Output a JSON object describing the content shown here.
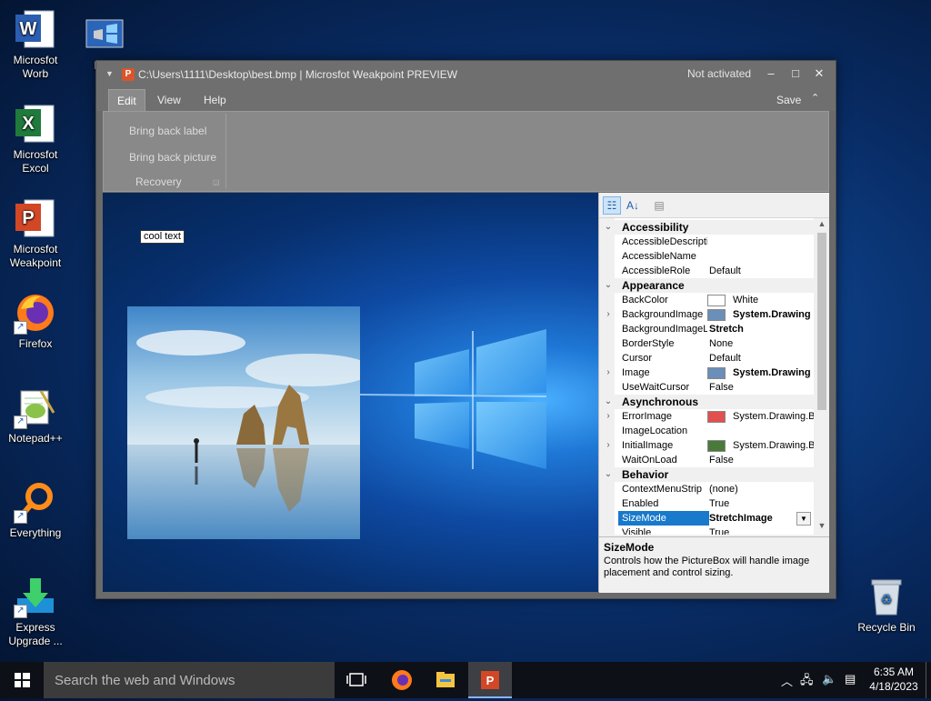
{
  "desktop": {
    "icons": [
      {
        "label": "Microsfot Worb",
        "icon": "word-icon"
      },
      {
        "label": "Microsfot Excol",
        "icon": "excel-icon"
      },
      {
        "label": "Microsfot Weakpoint",
        "icon": "powerpoint-icon"
      },
      {
        "label": "Firefox",
        "icon": "firefox-icon"
      },
      {
        "label": "Notepad++",
        "icon": "notepad-plus-plus-icon"
      },
      {
        "label": "Everything",
        "icon": "everything-search-icon"
      },
      {
        "label": "Express Upgrade ...",
        "icon": "download-arrow-icon"
      },
      {
        "label": "best",
        "icon": "bitmap-file-icon"
      },
      {
        "label": "Recycle Bin",
        "icon": "recycle-bin-icon"
      }
    ]
  },
  "window": {
    "app_icon_letter": "P",
    "title": "C:\\Users\\1111\\Desktop\\best.bmp | Microsfot Weakpoint PREVIEW",
    "status": "Not activated",
    "controls": {
      "minimize": "‒",
      "maximize": "□",
      "close": "✕"
    },
    "tabs": [
      {
        "label": "Edit",
        "active": true
      },
      {
        "label": "View",
        "active": false
      },
      {
        "label": "Help",
        "active": false
      }
    ],
    "save_label": "Save",
    "ribbon": {
      "buttons": [
        "Bring back label",
        "Bring back picture"
      ],
      "group_label": "Recovery"
    },
    "canvas": {
      "label_text": "cool text"
    }
  },
  "property_grid": {
    "rows": [
      {
        "type": "category",
        "name": "Accessibility"
      },
      {
        "type": "prop",
        "name": "AccessibleDescripti",
        "value": ""
      },
      {
        "type": "prop",
        "name": "AccessibleName",
        "value": ""
      },
      {
        "type": "prop",
        "name": "AccessibleRole",
        "value": "Default"
      },
      {
        "type": "category",
        "name": "Appearance"
      },
      {
        "type": "prop",
        "name": "BackColor",
        "value": "White",
        "swatch": "#ffffff"
      },
      {
        "type": "prop",
        "name": "BackgroundImage",
        "value": "System.Drawing",
        "bold": true,
        "expand": true,
        "swatch": "#6a8fb8"
      },
      {
        "type": "prop",
        "name": "BackgroundImageL",
        "value": "Stretch",
        "bold": true
      },
      {
        "type": "prop",
        "name": "BorderStyle",
        "value": "None"
      },
      {
        "type": "prop",
        "name": "Cursor",
        "value": "Default"
      },
      {
        "type": "prop",
        "name": "Image",
        "value": "System.Drawing",
        "bold": true,
        "expand": true,
        "swatch": "#6a8fb8"
      },
      {
        "type": "prop",
        "name": "UseWaitCursor",
        "value": "False"
      },
      {
        "type": "category",
        "name": "Asynchronous"
      },
      {
        "type": "prop",
        "name": "ErrorImage",
        "value": "System.Drawing.Bi",
        "expand": true,
        "swatch": "#e25050"
      },
      {
        "type": "prop",
        "name": "ImageLocation",
        "value": ""
      },
      {
        "type": "prop",
        "name": "InitialImage",
        "value": "System.Drawing.Bi",
        "expand": true,
        "swatch": "#4a7a3a"
      },
      {
        "type": "prop",
        "name": "WaitOnLoad",
        "value": "False"
      },
      {
        "type": "category",
        "name": "Behavior"
      },
      {
        "type": "prop",
        "name": "ContextMenuStrip",
        "value": "(none)"
      },
      {
        "type": "prop",
        "name": "Enabled",
        "value": "True"
      },
      {
        "type": "prop",
        "name": "SizeMode",
        "value": "StretchImage",
        "bold": true,
        "selected": true
      },
      {
        "type": "prop",
        "name": "Visible",
        "value": "True"
      }
    ],
    "description": {
      "title": "SizeMode",
      "text": "Controls how the PictureBox will handle image placement and control sizing."
    }
  },
  "taskbar": {
    "search_placeholder": "Search the web and Windows",
    "time": "6:35 AM",
    "date": "4/18/2023"
  }
}
